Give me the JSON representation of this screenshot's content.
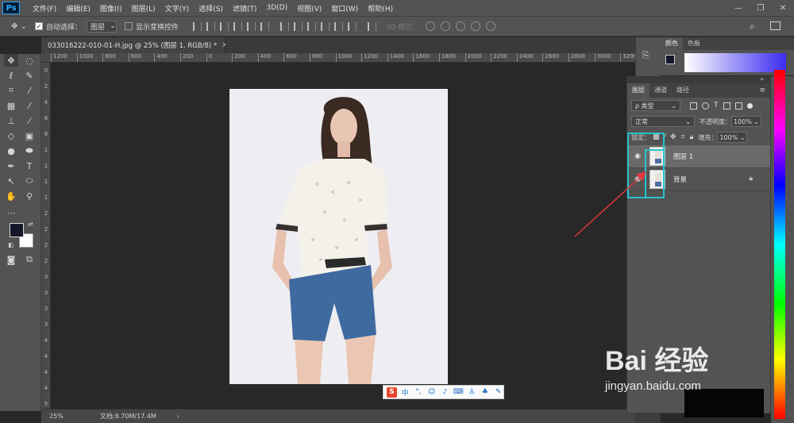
{
  "app": {
    "logo": "Ps",
    "menu": [
      "文件(F)",
      "编辑(E)",
      "图像(I)",
      "图层(L)",
      "文字(Y)",
      "选择(S)",
      "滤镜(T)",
      "3D(D)",
      "视图(V)",
      "窗口(W)",
      "帮助(H)"
    ],
    "window_controls": [
      "—",
      "❐",
      "✕"
    ]
  },
  "options": {
    "auto_select_label": "自动选择：",
    "auto_select_value": "图层",
    "show_transform_label": "显示变换控件",
    "mode_3d_label": "3D 模式："
  },
  "document": {
    "tab_title": "033016222-010-01-H.jpg @ 25% (图层 1, RGB/8) *",
    "tab_close": "×",
    "zoom": "25%",
    "doc_info": "文档:8.70M/17.4M",
    "ruler_h": [
      "1200",
      "1000",
      "800",
      "600",
      "400",
      "200",
      "0",
      "200",
      "400",
      "600",
      "800",
      "1000",
      "1200",
      "1400",
      "1600",
      "1800",
      "2000",
      "2200",
      "2400",
      "2600",
      "2800",
      "3000",
      "3200"
    ],
    "ruler_v": [
      "0",
      "2",
      "4",
      "6",
      "8",
      "1",
      "1",
      "1",
      "1",
      "2",
      "2",
      "2",
      "2",
      "3",
      "3",
      "3",
      "3",
      "4",
      "4",
      "4",
      "4",
      "5"
    ]
  },
  "color_panel": {
    "tabs": [
      "颜色",
      "色板"
    ]
  },
  "layers_panel": {
    "tabs": [
      "图层",
      "通道",
      "路径"
    ],
    "filter_label": "ρ 类型",
    "blend_mode": "正常",
    "opacity_label": "不透明度：",
    "opacity_value": "100%",
    "lock_label": "锁定：",
    "fill_label": "填充：",
    "fill_value": "100%",
    "layers": [
      {
        "name": "图层 1",
        "visible": true,
        "selected": true,
        "locked": false
      },
      {
        "name": "背景",
        "visible": true,
        "selected": false,
        "locked": true
      }
    ]
  },
  "ime": {
    "brand": "S",
    "mode": "中"
  },
  "watermark": {
    "logo": "Bai 经验",
    "url": "jingyan.baidu.com"
  },
  "colors": {
    "annotation": "#27c4cc",
    "arrow": "#e0393e",
    "ps_blue": "#31a8ff"
  }
}
